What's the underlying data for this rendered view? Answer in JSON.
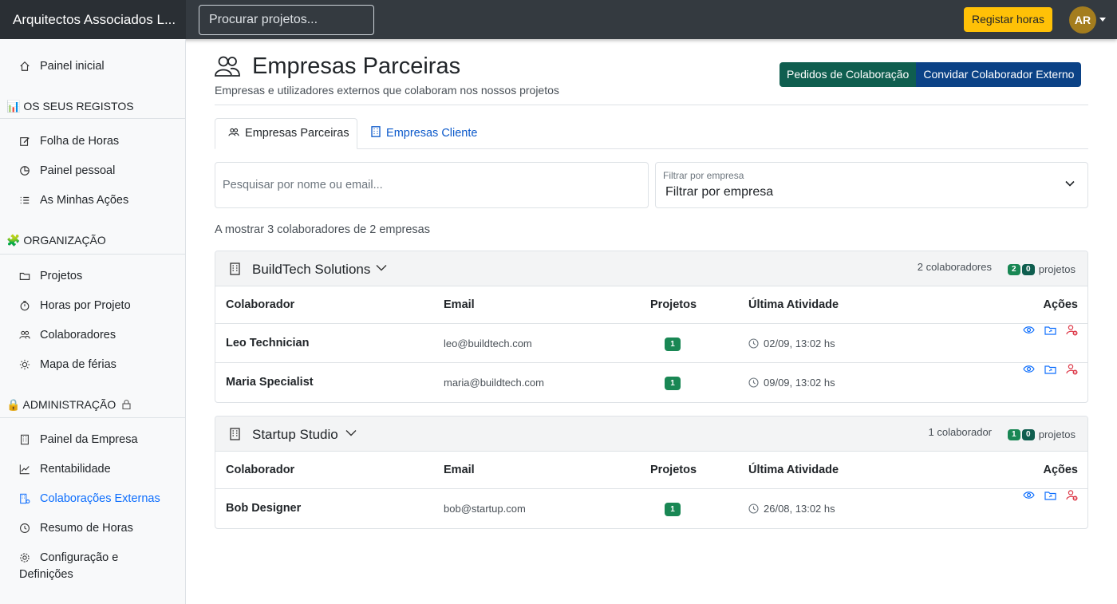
{
  "topbar": {
    "brand": "Arquitectos Associados L...",
    "search_placeholder": "Procurar projetos...",
    "log_hours_label": "Registar horas",
    "avatar_initials": "AR"
  },
  "sidebar": {
    "home": "Painel inicial",
    "section_records": "📊 OS SEUS REGISTOS",
    "timesheet": "Folha de Horas",
    "personal_dashboard": "Painel pessoal",
    "my_actions": "As Minhas Ações",
    "section_org": "🧩 ORGANIZAÇÃO",
    "projects": "Projetos",
    "hours_per_project": "Horas por Projeto",
    "collaborators": "Colaboradores",
    "vacation_map": "Mapa de férias",
    "section_admin": "🔒 ADMINISTRAÇÃO",
    "company_dashboard": "Painel da Empresa",
    "profitability": "Rentabilidade",
    "external_collabs": "Colaborações Externas",
    "hours_summary": "Resumo de Horas",
    "settings_line1": "Configuração e",
    "settings_line2": "Definições"
  },
  "page": {
    "title": "Empresas Parceiras",
    "subtitle": "Empresas e utilizadores externos que colaboram nos nossos projetos",
    "btn_requests": "Pedidos de Colaboração",
    "btn_invite": "Convidar Colaborador Externo"
  },
  "tabs": {
    "partners": "Empresas Parceiras",
    "clients": "Empresas Cliente"
  },
  "filters": {
    "search_placeholder": "Pesquisar por nome ou email...",
    "company_label": "Filtrar por empresa",
    "company_value": "Filtrar por empresa"
  },
  "summary": "A mostrar 3 colaboradores de 2 empresas",
  "table_headers": {
    "collaborator": "Colaborador",
    "email": "Email",
    "projects": "Projetos",
    "last_activity": "Última Atividade",
    "actions": "Ações"
  },
  "companies": [
    {
      "name": "BuildTech Solutions",
      "count_text": "2 colaboradores",
      "badge_a": "2",
      "badge_b": "0",
      "projects_word": "projetos",
      "rows": [
        {
          "name": "Leo Technician",
          "email": "leo@buildtech.com",
          "projects": "1",
          "last_activity": "02/09, 13:02 hs"
        },
        {
          "name": "Maria Specialist",
          "email": "maria@buildtech.com",
          "projects": "1",
          "last_activity": "09/09, 13:02 hs"
        }
      ]
    },
    {
      "name": "Startup Studio",
      "count_text": "1 colaborador",
      "badge_a": "1",
      "badge_b": "0",
      "projects_word": "projetos",
      "rows": [
        {
          "name": "Bob Designer",
          "email": "bob@startup.com",
          "projects": "1",
          "last_activity": "26/08, 13:02 hs"
        }
      ]
    }
  ],
  "colors": {
    "topbar": "#343a40",
    "accent_yellow": "#ffc107",
    "requests_green": "#0f5e4f",
    "invite_blue": "#0b4286",
    "badge_green": "#198754",
    "active_link": "#0d6efd"
  }
}
